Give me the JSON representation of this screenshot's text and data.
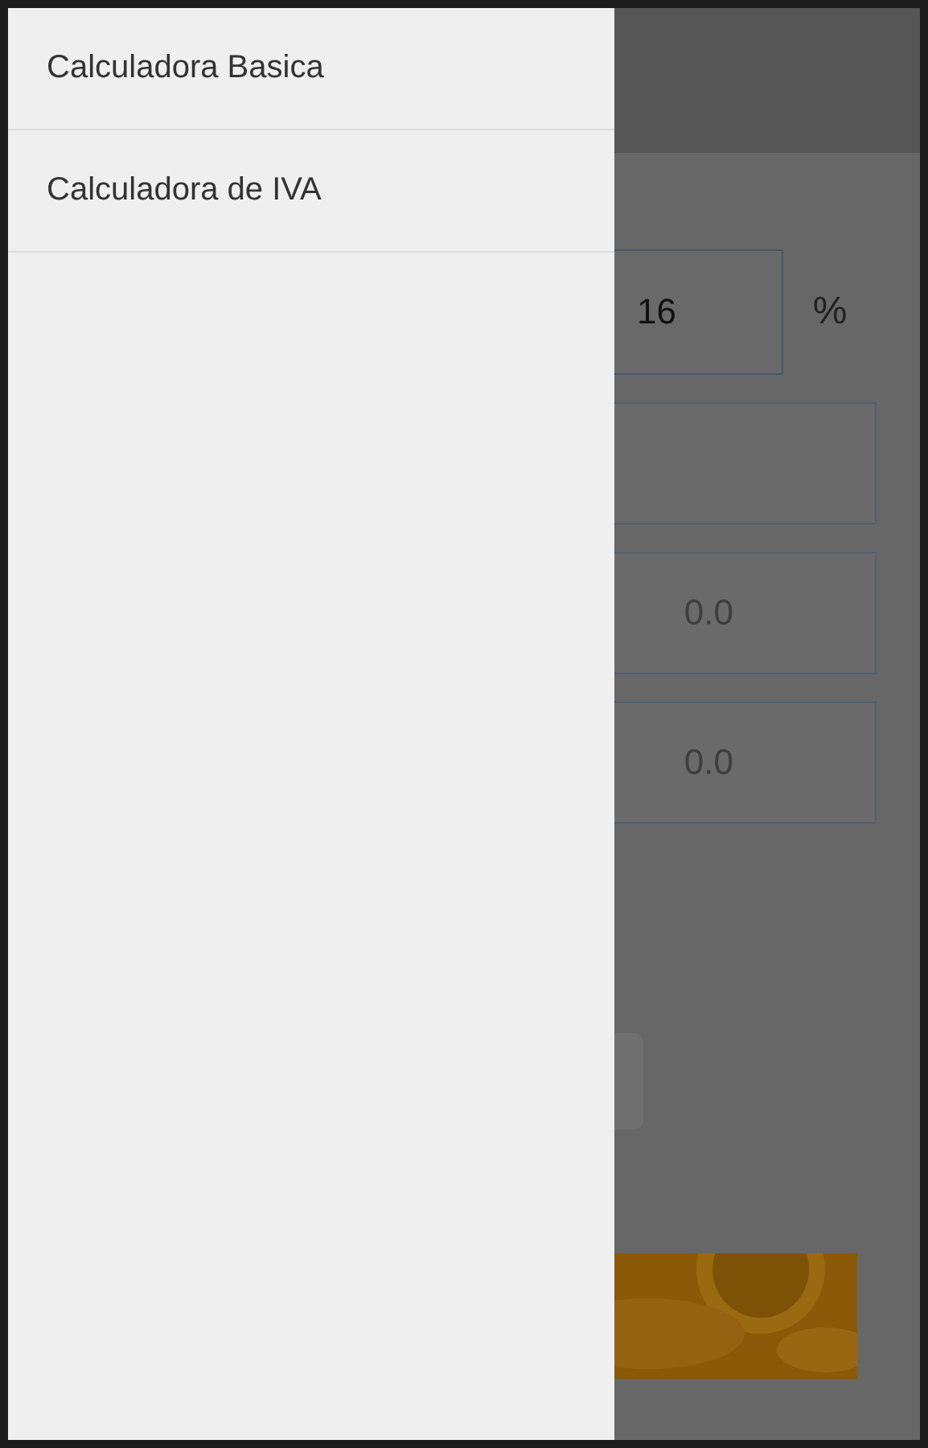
{
  "drawer": {
    "items": [
      {
        "label": "Calculadora Basica",
        "selected": false
      },
      {
        "label": "Calculadora de IVA",
        "selected": false
      }
    ]
  },
  "screen": {
    "rate_field": {
      "value": "16"
    },
    "rate_unit": "%",
    "controls": [
      {
        "kind": "input"
      },
      {
        "kind": "input",
        "placeholder": "0.0"
      },
      {
        "kind": "input",
        "placeholder": "0.0"
      },
      {
        "kind": "button"
      }
    ]
  }
}
